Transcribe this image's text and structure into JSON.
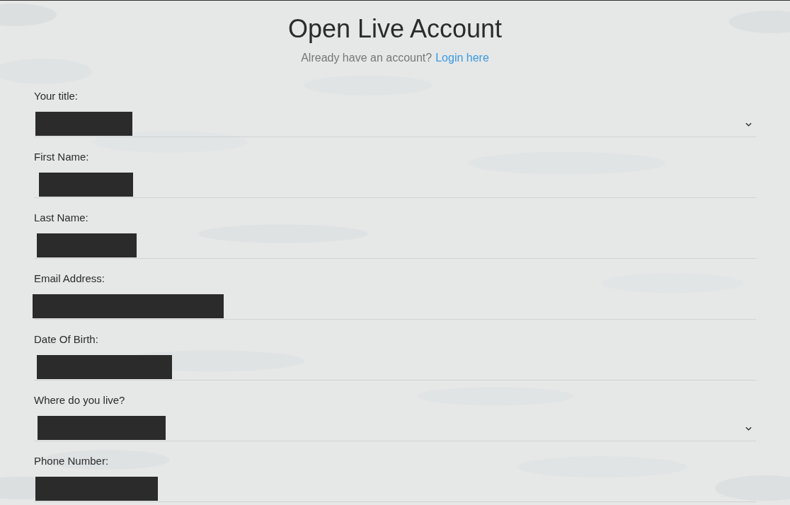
{
  "title": "Open Live Account",
  "subtitle": {
    "text": "Already have an account?",
    "link": "Login here"
  },
  "fields": [
    {
      "label": "Your title:",
      "kind": "select",
      "redacted": true
    },
    {
      "label": "First Name:",
      "kind": "text",
      "redacted": true
    },
    {
      "label": "Last Name:",
      "kind": "text",
      "redacted": true
    },
    {
      "label": "Email Address:",
      "kind": "text",
      "redacted": true
    },
    {
      "label": "Date Of Birth:",
      "kind": "text",
      "redacted": true
    },
    {
      "label": "Where do you live?",
      "kind": "select",
      "redacted": true
    },
    {
      "label": "Phone Number:",
      "kind": "text",
      "redacted": true
    }
  ]
}
